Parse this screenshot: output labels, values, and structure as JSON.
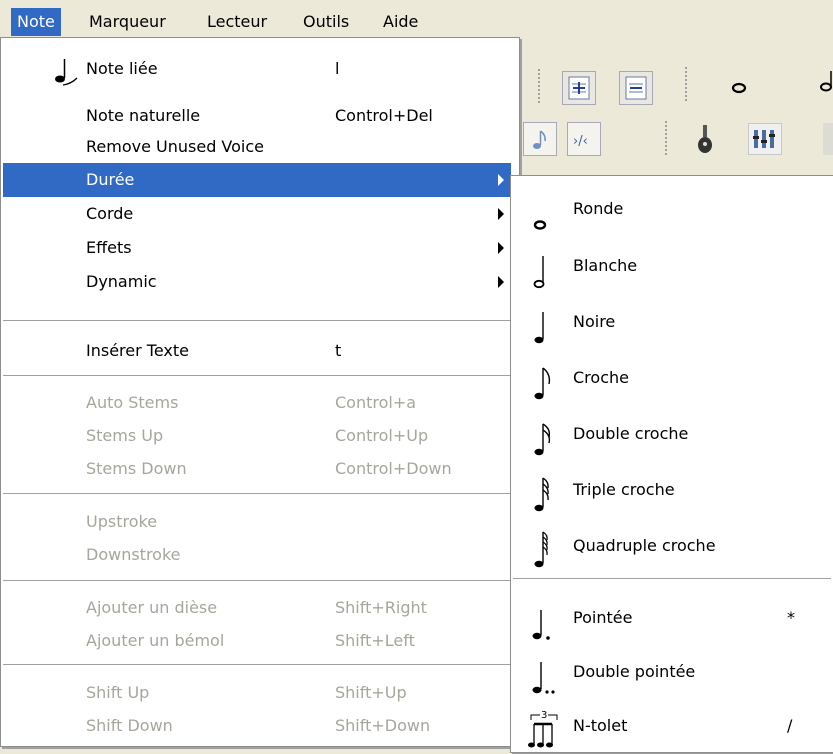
{
  "menubar": {
    "items": [
      {
        "label": "Note",
        "active": true
      },
      {
        "label": "Marqueur",
        "active": false
      },
      {
        "label": "Lecteur",
        "active": false
      },
      {
        "label": "Outils",
        "active": false
      },
      {
        "label": "Aide",
        "active": false
      }
    ]
  },
  "note_menu": {
    "items": [
      {
        "label": "Note liée",
        "shortcut": "l",
        "icon": "tied-note-icon",
        "state": "enabled"
      },
      {
        "label": "Note naturelle",
        "shortcut": "Control+Del",
        "state": "enabled"
      },
      {
        "label": "Remove Unused Voice",
        "shortcut": "",
        "state": "enabled"
      },
      {
        "label": "Durée",
        "submenu": true,
        "state": "highlighted"
      },
      {
        "label": "Corde",
        "submenu": true,
        "state": "enabled"
      },
      {
        "label": "Effets",
        "submenu": true,
        "state": "enabled"
      },
      {
        "label": "Dynamic",
        "submenu": true,
        "state": "enabled"
      },
      {
        "label": "Insérer Texte",
        "shortcut": "t",
        "state": "enabled"
      },
      {
        "label": "Auto Stems",
        "shortcut": "Control+a",
        "state": "disabled"
      },
      {
        "label": "Stems Up",
        "shortcut": "Control+Up",
        "state": "disabled"
      },
      {
        "label": "Stems Down",
        "shortcut": "Control+Down",
        "state": "disabled"
      },
      {
        "label": "Upstroke",
        "shortcut": "",
        "state": "disabled"
      },
      {
        "label": "Downstroke",
        "shortcut": "",
        "state": "disabled"
      },
      {
        "label": "Ajouter un dièse",
        "shortcut": "Shift+Right",
        "state": "disabled"
      },
      {
        "label": "Ajouter un bémol",
        "shortcut": "Shift+Left",
        "state": "disabled"
      },
      {
        "label": "Shift Up",
        "shortcut": "Shift+Up",
        "state": "disabled"
      },
      {
        "label": "Shift Down",
        "shortcut": "Shift+Down",
        "state": "disabled"
      }
    ]
  },
  "duration_submenu": {
    "items": [
      {
        "label": "Ronde",
        "shortcut": "",
        "icon": "whole-note-icon"
      },
      {
        "label": "Blanche",
        "shortcut": "",
        "icon": "half-note-icon"
      },
      {
        "label": "Noire",
        "shortcut": "",
        "icon": "quarter-note-icon"
      },
      {
        "label": "Croche",
        "shortcut": "",
        "icon": "eighth-note-icon"
      },
      {
        "label": "Double croche",
        "shortcut": "",
        "icon": "sixteenth-note-icon"
      },
      {
        "label": "Triple croche",
        "shortcut": "",
        "icon": "thirty-second-note-icon"
      },
      {
        "label": "Quadruple croche",
        "shortcut": "",
        "icon": "sixty-fourth-note-icon"
      },
      {
        "label": "Pointée",
        "shortcut": "*",
        "icon": "dotted-note-icon"
      },
      {
        "label": "Double pointée",
        "shortcut": "",
        "icon": "double-dotted-note-icon"
      },
      {
        "label": "N-tolet",
        "shortcut": "/",
        "icon": "tuplet-icon"
      }
    ]
  },
  "colors": {
    "highlight": "#316ac5",
    "menubar_bg": "#ece9d8",
    "disabled_text": "#a6a69c"
  }
}
